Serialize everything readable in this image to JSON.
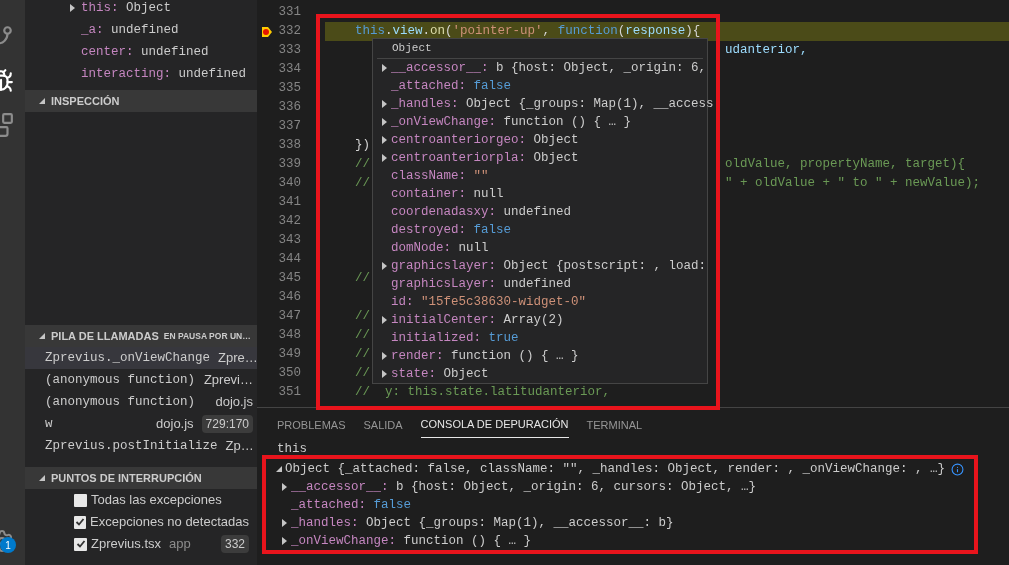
{
  "variables": [
    {
      "name": "this:",
      "value": "Object",
      "expandable": true
    },
    {
      "name": "_a:",
      "value": "undefined",
      "expandable": false
    },
    {
      "name": "center:",
      "value": "undefined",
      "expandable": false
    },
    {
      "name": "interacting:",
      "value": "undefined",
      "expandable": false
    }
  ],
  "watch": {
    "title": "INSPECCIÓN",
    "expanded": true
  },
  "call_stack": {
    "title": "PILA DE LLAMADAS",
    "status": "EN PAUSA POR UN…",
    "expanded": true,
    "frames": [
      {
        "name": "Zprevius._onViewChange",
        "source": "Zpre…",
        "selected": true
      },
      {
        "name": "(anonymous function)",
        "source": "Zprevi…",
        "selected": false
      },
      {
        "name": "(anonymous function)",
        "source": "dojo.js",
        "selected": false
      },
      {
        "name": "w",
        "source": "dojo.js",
        "position": "729:170",
        "selected": false
      },
      {
        "name": "Zprevius.postInitialize",
        "source": "Zp…",
        "selected": false
      }
    ]
  },
  "breakpoints": {
    "title": "PUNTOS DE INTERRUPCIÓN",
    "expanded": true,
    "items": [
      {
        "label": "Todas las excepciones",
        "checked": false
      },
      {
        "label": "Excepciones no detectadas",
        "checked": true
      },
      {
        "label": "Zprevius.tsx",
        "detail": "app",
        "line": "332",
        "checked": true
      }
    ]
  },
  "activity_badge": "1",
  "editor": {
    "lines": [
      {
        "number": "331",
        "breakpoint": false,
        "current": false
      },
      {
        "number": "332",
        "breakpoint": true,
        "current": true,
        "left": [
          {
            "t": "this",
            "kind": "keyword"
          },
          {
            "t": ".",
            "kind": "plain"
          },
          {
            "t": "view",
            "kind": "prop"
          },
          {
            "t": ".",
            "kind": "plain"
          },
          {
            "t": "on",
            "kind": "fn"
          },
          {
            "t": "(",
            "kind": "plain"
          },
          {
            "t": "'pointer-up'",
            "kind": "string"
          },
          {
            "t": ", ",
            "kind": "plain"
          },
          {
            "t": "function",
            "kind": "keyword"
          },
          {
            "t": "(",
            "kind": "plain"
          },
          {
            "t": "response",
            "kind": "prop"
          },
          {
            "t": "){",
            "kind": "plain"
          }
        ]
      },
      {
        "number": "333",
        "breakpoint": false,
        "current": false,
        "right": [
          {
            "t": "udanterior,",
            "kind": "prop"
          }
        ]
      },
      {
        "number": "334",
        "breakpoint": false,
        "current": false
      },
      {
        "number": "335",
        "breakpoint": false,
        "current": false
      },
      {
        "number": "336",
        "breakpoint": false,
        "current": false
      },
      {
        "number": "337",
        "breakpoint": false,
        "current": false
      },
      {
        "number": "338",
        "breakpoint": false,
        "current": false,
        "left": [
          {
            "t": "})",
            "kind": "plain"
          }
        ]
      },
      {
        "number": "339",
        "breakpoint": false,
        "current": false,
        "left": [
          {
            "t": "//",
            "kind": "comment"
          }
        ],
        "right": [
          {
            "t": "oldValue, propertyName, target){",
            "kind": "comment"
          }
        ]
      },
      {
        "number": "340",
        "breakpoint": false,
        "current": false,
        "left": [
          {
            "t": "//",
            "kind": "comment"
          }
        ],
        "right": [
          {
            "t": "\" + oldValue + \" to \" + newValue);",
            "kind": "comment"
          }
        ]
      },
      {
        "number": "341",
        "breakpoint": false,
        "current": false
      },
      {
        "number": "342",
        "breakpoint": false,
        "current": false
      },
      {
        "number": "343",
        "breakpoint": false,
        "current": false
      },
      {
        "number": "344",
        "breakpoint": false,
        "current": false
      },
      {
        "number": "345",
        "breakpoint": false,
        "current": false,
        "left": [
          {
            "t": "//",
            "kind": "comment"
          }
        ]
      },
      {
        "number": "346",
        "breakpoint": false,
        "current": false
      },
      {
        "number": "347",
        "breakpoint": false,
        "current": false,
        "left": [
          {
            "t": "//",
            "kind": "comment"
          }
        ]
      },
      {
        "number": "348",
        "breakpoint": false,
        "current": false,
        "left": [
          {
            "t": "//",
            "kind": "comment"
          }
        ]
      },
      {
        "number": "349",
        "breakpoint": false,
        "current": false,
        "left": [
          {
            "t": "//",
            "kind": "comment"
          }
        ]
      },
      {
        "number": "350",
        "breakpoint": false,
        "current": false,
        "left": [
          {
            "t": "//",
            "kind": "comment"
          }
        ]
      },
      {
        "number": "351",
        "breakpoint": false,
        "current": false,
        "left": [
          {
            "t": "//  y: this.state.latitudanterior,",
            "kind": "comment"
          }
        ]
      }
    ]
  },
  "hover": {
    "title": "Object",
    "rows": [
      {
        "name": "__accessor__:",
        "value": "b {host: Object, _origin: 6,",
        "kind": "object",
        "expandable": true
      },
      {
        "name": "_attached:",
        "value": "false",
        "kind": "literal",
        "expandable": false
      },
      {
        "name": "_handles:",
        "value": "Object {_groups: Map(1), __access",
        "kind": "object",
        "expandable": true
      },
      {
        "name": "_onViewChange:",
        "value": "function () { … }",
        "kind": "object",
        "expandable": true
      },
      {
        "name": "centroanteriorgeo:",
        "value": "Object",
        "kind": "object",
        "expandable": true
      },
      {
        "name": "centroanteriorpla:",
        "value": "Object",
        "kind": "object",
        "expandable": true
      },
      {
        "name": "className:",
        "value": "\"\"",
        "kind": "string",
        "expandable": false
      },
      {
        "name": "container:",
        "value": "null",
        "kind": "object",
        "expandable": false
      },
      {
        "name": "coordenadasxy:",
        "value": "undefined",
        "kind": "object",
        "expandable": false
      },
      {
        "name": "destroyed:",
        "value": "false",
        "kind": "literal",
        "expandable": false
      },
      {
        "name": "domNode:",
        "value": "null",
        "kind": "object",
        "expandable": false
      },
      {
        "name": "graphicslayer:",
        "value": "Object {postscript: , load:",
        "kind": "object",
        "expandable": true
      },
      {
        "name": "graphicsLayer:",
        "value": "undefined",
        "kind": "object",
        "expandable": false
      },
      {
        "name": "id:",
        "value": "\"15fe5c38630-widget-0\"",
        "kind": "string",
        "expandable": false
      },
      {
        "name": "initialCenter:",
        "value": "Array(2)",
        "kind": "object",
        "expandable": true
      },
      {
        "name": "initialized:",
        "value": "true",
        "kind": "literal",
        "expandable": false
      },
      {
        "name": "render:",
        "value": "function () { … }",
        "kind": "object",
        "expandable": true
      },
      {
        "name": "state:",
        "value": "Object",
        "kind": "object",
        "expandable": true
      }
    ]
  },
  "panel": {
    "tabs": [
      {
        "label": "PROBLEMAS",
        "selected": false
      },
      {
        "label": "SALIDA",
        "selected": false
      },
      {
        "label": "CONSOLA DE DEPURACIÓN",
        "selected": true
      },
      {
        "label": "TERMINAL",
        "selected": false
      }
    ],
    "input": "this",
    "result": {
      "summary": "Object {_attached: false, className: \"\", _handles: Object, render: , _onViewChange: , …}",
      "expanded": true,
      "rows": [
        {
          "name": "__accessor__:",
          "value": "b {host: Object, _origin: 6, cursors: Object, …}",
          "kind": "object",
          "expandable": true
        },
        {
          "name": "_attached:",
          "value": "false",
          "kind": "literal",
          "expandable": false
        },
        {
          "name": "_handles:",
          "value": "Object {_groups: Map(1), __accessor__: b}",
          "kind": "object",
          "expandable": true
        },
        {
          "name": "_onViewChange:",
          "value": "function () { … }",
          "kind": "object",
          "expandable": true
        }
      ]
    }
  }
}
